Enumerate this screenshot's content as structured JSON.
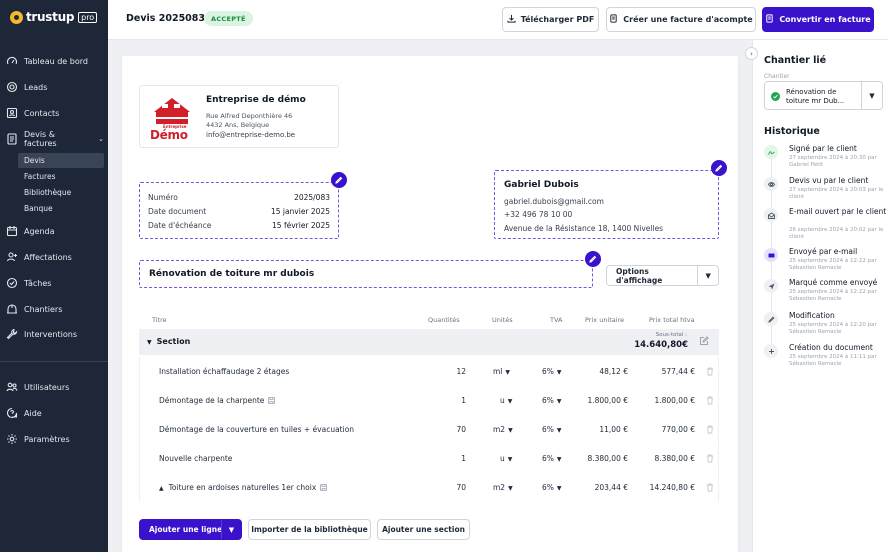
{
  "brand": {
    "name": "trustup",
    "suffix": "pro",
    "accent": "#3b12cc",
    "logo_color": "#f5b72b"
  },
  "sidebar": {
    "items": [
      {
        "label": "Tableau de bord",
        "icon": "gauge-icon"
      },
      {
        "label": "Leads",
        "icon": "target-icon"
      },
      {
        "label": "Contacts",
        "icon": "contact-card-icon"
      },
      {
        "label": "Devis & factures",
        "icon": "document-icon"
      },
      {
        "label": "Agenda",
        "icon": "calendar-icon"
      },
      {
        "label": "Affectations",
        "icon": "user-plus-icon"
      },
      {
        "label": "Tâches",
        "icon": "check-circle-icon"
      },
      {
        "label": "Chantiers",
        "icon": "building-icon"
      },
      {
        "label": "Interventions",
        "icon": "wrench-icon"
      }
    ],
    "sub_items": [
      "Devis",
      "Factures",
      "Bibliothèque",
      "Banque"
    ],
    "bottom_items": [
      {
        "label": "Utilisateurs",
        "icon": "users-icon"
      },
      {
        "label": "Aide",
        "icon": "help-icon"
      },
      {
        "label": "Paramètres",
        "icon": "gear-icon"
      }
    ]
  },
  "header": {
    "title": "Devis 2025083",
    "status": "ACCEPTÉ",
    "download_label": "Télécharger PDF",
    "deposit_label": "Créer une facture d'acompte",
    "convert_label": "Convertir en facture"
  },
  "company": {
    "logo_top": "Entreprise",
    "logo_word": "Démo",
    "name": "Entreprise de démo",
    "address_line1": "Rue Alfred Deponthière 46",
    "address_line2": "4432 Ans, Belgique",
    "email": "info@entreprise-demo.be"
  },
  "meta": {
    "number_label": "Numéro",
    "number": "2025/083",
    "date_label": "Date document",
    "date": "15 janvier 2025",
    "due_label": "Date d'échéance",
    "due": "15 février 2025"
  },
  "client": {
    "name": "Gabriel Dubois",
    "email": "gabriel.dubois@gmail.com",
    "phone": "+32 496 78 10 00",
    "address": "Avenue de la Résistance 18, 1400 Nivelles"
  },
  "project_title": "Rénovation de toiture mr dubois",
  "display_options_label": "Options d'affichage",
  "table": {
    "columns": [
      "Titre",
      "Quantités",
      "Unités",
      "TVA",
      "Prix unitaire",
      "Prix total htva"
    ],
    "section": {
      "label": "Section",
      "subtotal_label": "Sous-total :",
      "subtotal": "14.640,80€"
    },
    "rows": [
      {
        "title": "Installation échaffaudage 2 étages",
        "qty": "12",
        "unit": "ml",
        "vat": "6%",
        "unit_price": "48,12 €",
        "total": "577,44 €"
      },
      {
        "title": "Démontage de la charpente",
        "qty": "1",
        "unit": "u",
        "vat": "6%",
        "unit_price": "1.800,00 €",
        "total": "1.800,00 €"
      },
      {
        "title": "Démontage de la couverture en tuiles + évacuation",
        "qty": "70",
        "unit": "m2",
        "vat": "6%",
        "unit_price": "11,00 €",
        "total": "770,00 €"
      },
      {
        "title": "Nouvelle charpente",
        "qty": "1",
        "unit": "u",
        "vat": "6%",
        "unit_price": "8.380,00 €",
        "total": "8.380,00 €"
      },
      {
        "title": "Toiture en ardoises naturelles 1er choix",
        "qty": "70",
        "unit": "m2",
        "vat": "6%",
        "unit_price": "203,44 €",
        "total": "14.240,80 €"
      }
    ]
  },
  "actions": {
    "add_line": "Ajouter une ligne",
    "import": "Importer de la bibliothèque",
    "add_section": "Ajouter une section"
  },
  "right_panel": {
    "linked_title": "Chantier lié",
    "field_label": "Chantier",
    "chantier_value": "Rénovation de toiture mr Dub...",
    "history_title": "Historique",
    "events": [
      {
        "title": "Signé par le client",
        "sub": "27 septembre 2024 à 20:30 par Gabriel Petit",
        "icon": "signature-icon"
      },
      {
        "title": "Devis vu par le client",
        "sub": "27 septembre 2024 à 20:03 par le client",
        "icon": "eye-icon"
      },
      {
        "title": "E-mail ouvert par le client",
        "sub": "26 septembre 2024 à 20:02 par le client",
        "icon": "mail-open-icon"
      },
      {
        "title": "Envoyé par e-mail",
        "sub": "25 septembre 2024 à 12:22 par Sébastien Remacle",
        "icon": "mail-icon"
      },
      {
        "title": "Marqué comme envoyé",
        "sub": "25 septembre 2024 à 12:22 par Sébastien Remacle",
        "icon": "send-icon"
      },
      {
        "title": "Modification",
        "sub": "25 septembre 2024 à 12:20 par Sébastien Remacle",
        "icon": "pencil-icon"
      },
      {
        "title": "Création du document",
        "sub": "25 septembre 2024 à 11:11 par Sébastien Remacle",
        "icon": "plus-icon"
      }
    ]
  }
}
